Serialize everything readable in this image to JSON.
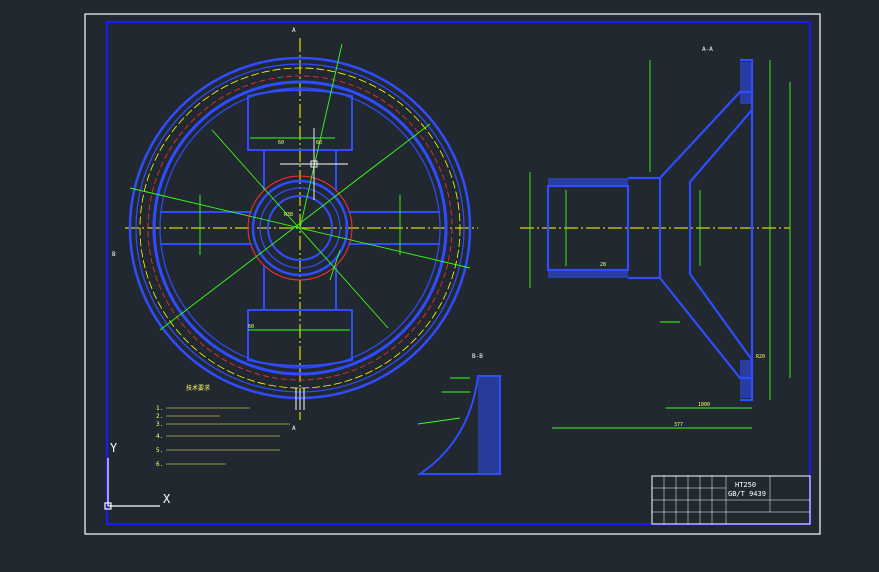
{
  "drawing": {
    "sheet_marks": {
      "section_a_top": "A",
      "section_a_bottom": "A",
      "section_b_left": "B",
      "view_aa": "A-A",
      "view_bb": "B-B"
    },
    "notes_title": "技术要求",
    "notes": [
      "1.",
      "2.",
      "3.",
      "4.",
      "5.",
      "6."
    ],
    "dimensions": {
      "d1": "60",
      "d2": "60",
      "d3": "R38",
      "d4": "377",
      "d5": "1000",
      "d6": "R20",
      "d7": "28",
      "d8": "60"
    },
    "title_block": {
      "material": "HT250",
      "standard": "GB/T 9439"
    },
    "axes": {
      "y_label": "Y",
      "x_label": "X"
    },
    "colors": {
      "background": "#212830",
      "border": "#ffffff",
      "frame": "#1a1aff",
      "part": "#2f4dff",
      "dimension": "#39ff14",
      "centerline": "#ffff00",
      "hidden": "#ff3030",
      "text_yellow": "#ffff66"
    }
  }
}
